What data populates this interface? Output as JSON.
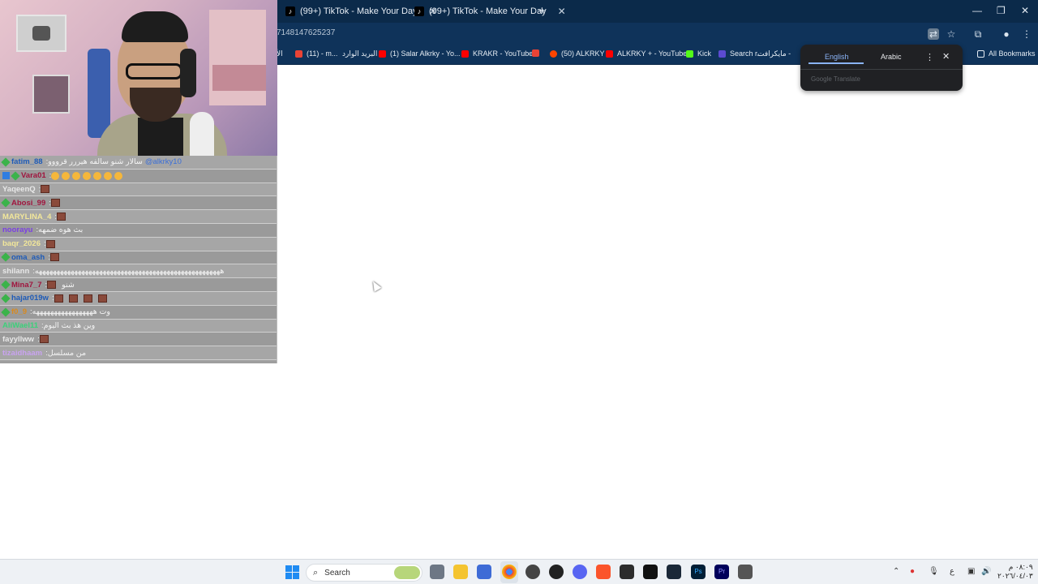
{
  "browser": {
    "tabs": [
      {
        "title": "(99+) TikTok - Make Your Day"
      },
      {
        "title": "(99+) TikTok - Make Your Day"
      }
    ],
    "url_fragment": "7148147625237",
    "bookmarks": [
      {
        "label": "الأ",
        "color": "#888888"
      },
      {
        "label": "(11) - m...",
        "color": "#ea4335"
      },
      {
        "label": "البريد الوارد",
        "color": "#ea4335"
      },
      {
        "label": "(1) Salar Alkrky - Yo...",
        "color": "#ff0000"
      },
      {
        "label": "KRAKR - YouTube",
        "color": "#ff0000"
      },
      {
        "label": "(50) ALKRKY",
        "color": "#ff4500"
      },
      {
        "label": "ALKRKY + - YouTube",
        "color": "#ff0000"
      },
      {
        "label": "Kick",
        "color": "#53fc18"
      },
      {
        "label": "Search r...",
        "color": "#5b4bd1"
      },
      {
        "label": "مايكرافت -",
        "color": "#888888"
      },
      {
        "label": "All Bookmarks",
        "color": "#888888"
      }
    ],
    "translate": {
      "source": "English",
      "target": "Arabic",
      "brand": "Google Translate"
    }
  },
  "chat": [
    {
      "user": "fatim_88",
      "user_color": "#1e5bb8",
      "msg": "سالار شنو سالفه هيررر قرووو",
      "mention": "@alkrky10",
      "badge": "diamond",
      "emotes": 0
    },
    {
      "user": "Vara01",
      "user_color": "#a0153e",
      "msg": "",
      "badge": "multi",
      "emotes": 0,
      "emojis": 7
    },
    {
      "user": "YaqeenQ",
      "user_color": "#e8e8e8",
      "msg": "",
      "badge": "none",
      "emotes": 1
    },
    {
      "user": "Abosi_99",
      "user_color": "#a0153e",
      "msg": "",
      "badge": "diamond",
      "emotes": 1
    },
    {
      "user": "MARYLINA_4",
      "user_color": "#f2e79a",
      "msg": "",
      "badge": "none",
      "emotes": 1
    },
    {
      "user": "noorayu",
      "user_color": "#7b3fe4",
      "msg": "بث هوه ضمهه",
      "badge": "none",
      "emotes": 0
    },
    {
      "user": "baqr_2026",
      "user_color": "#f2e79a",
      "msg": "",
      "badge": "none",
      "emotes": 1
    },
    {
      "user": "oma_ash",
      "user_color": "#1e5bb8",
      "msg": "",
      "badge": "diamond",
      "emotes": 1
    },
    {
      "user": "shilann",
      "user_color": "#e8e8e8",
      "msg": "ههههههههههههههههههههههههههههههههههههههههههههههههههههه",
      "badge": "none",
      "emotes": 0
    },
    {
      "user": "Mina7_7",
      "user_color": "#a0153e",
      "msg": "شنو",
      "badge": "diamond",
      "emotes": 1
    },
    {
      "user": "hajar019w",
      "user_color": "#1e5bb8",
      "msg": "",
      "badge": "diamond",
      "emotes": 4
    },
    {
      "user": "f0_9",
      "user_color": "#d98a1e",
      "msg": "وت هههههههههههههههههه",
      "badge": "diamond",
      "emotes": 0
    },
    {
      "user": "AliWael11",
      "user_color": "#3bd17a",
      "msg": "وين هذ بث اليوم",
      "badge": "none",
      "emotes": 0
    },
    {
      "user": "fayyllww",
      "user_color": "#e8e8e8",
      "msg": "",
      "badge": "none",
      "emotes": 1
    },
    {
      "user": "tizaidhaam",
      "user_color": "#c9a3f0",
      "msg": "من مسلسل",
      "badge": "none",
      "emotes": 0
    }
  ],
  "taskbar": {
    "search_label": "Search",
    "lang": "ع",
    "time": "٠٨:٠٩ م",
    "date": "٢٠٢٦/٠٤/٠٣"
  }
}
